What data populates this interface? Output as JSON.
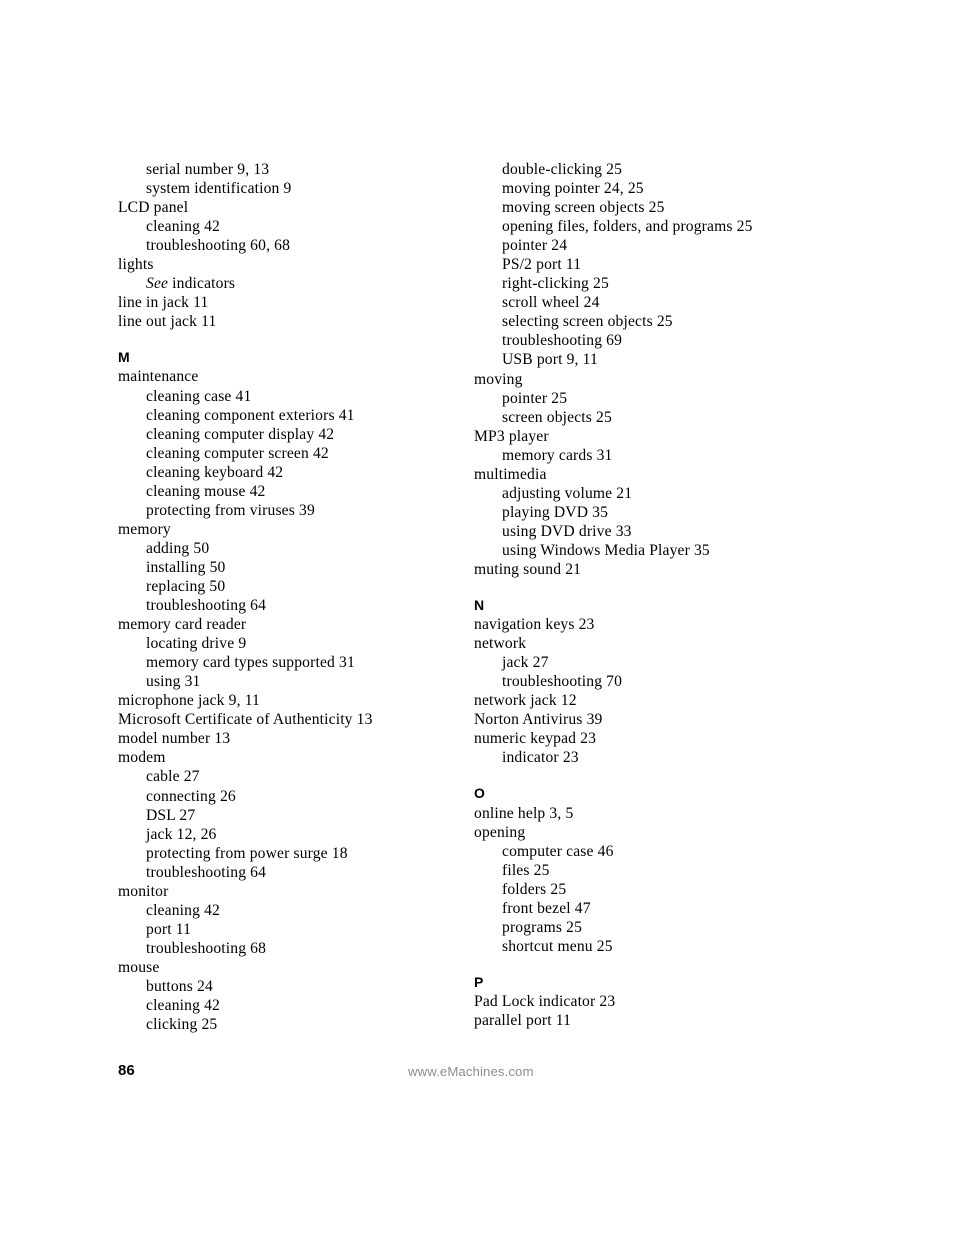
{
  "document": {
    "type": "index",
    "page_number": "86",
    "footer_url": "www.eMachines.com"
  },
  "columns": [
    {
      "name": "left-column",
      "blocks": [
        {
          "type": "entries",
          "entries": [
            {
              "level": 1,
              "text": "serial number 9, 13"
            },
            {
              "level": 1,
              "text": "system identification 9"
            },
            {
              "level": 0,
              "text": "LCD panel"
            },
            {
              "level": 1,
              "text": "cleaning 42"
            },
            {
              "level": 1,
              "text": "troubleshooting 60, 68"
            },
            {
              "level": 0,
              "text": "lights"
            },
            {
              "level": 1,
              "text": "See indicators",
              "italic_prefix": "See",
              "rest": " indicators"
            },
            {
              "level": 0,
              "text": "line in jack 11"
            },
            {
              "level": 0,
              "text": "line out jack 11"
            }
          ]
        },
        {
          "type": "section",
          "letter": "M",
          "entries": [
            {
              "level": 0,
              "text": "maintenance"
            },
            {
              "level": 1,
              "text": "cleaning case 41"
            },
            {
              "level": 1,
              "text": "cleaning component exteriors 41"
            },
            {
              "level": 1,
              "text": "cleaning computer display 42"
            },
            {
              "level": 1,
              "text": "cleaning computer screen 42"
            },
            {
              "level": 1,
              "text": "cleaning keyboard 42"
            },
            {
              "level": 1,
              "text": "cleaning mouse 42"
            },
            {
              "level": 1,
              "text": "protecting from viruses 39"
            },
            {
              "level": 0,
              "text": "memory"
            },
            {
              "level": 1,
              "text": "adding 50"
            },
            {
              "level": 1,
              "text": "installing 50"
            },
            {
              "level": 1,
              "text": "replacing 50"
            },
            {
              "level": 1,
              "text": "troubleshooting 64"
            },
            {
              "level": 0,
              "text": "memory card reader"
            },
            {
              "level": 1,
              "text": "locating drive 9"
            },
            {
              "level": 1,
              "text": "memory card types supported 31"
            },
            {
              "level": 1,
              "text": "using 31"
            },
            {
              "level": 0,
              "text": "microphone jack 9, 11"
            },
            {
              "level": 0,
              "text": "Microsoft Certificate of Authenticity 13"
            },
            {
              "level": 0,
              "text": "model number 13"
            },
            {
              "level": 0,
              "text": "modem"
            },
            {
              "level": 1,
              "text": "cable 27"
            },
            {
              "level": 1,
              "text": "connecting 26"
            },
            {
              "level": 1,
              "text": "DSL 27"
            },
            {
              "level": 1,
              "text": "jack 12, 26"
            },
            {
              "level": 1,
              "text": "protecting from power surge 18"
            },
            {
              "level": 1,
              "text": "troubleshooting 64"
            },
            {
              "level": 0,
              "text": "monitor"
            },
            {
              "level": 1,
              "text": "cleaning 42"
            },
            {
              "level": 1,
              "text": "port 11"
            },
            {
              "level": 1,
              "text": "troubleshooting 68"
            },
            {
              "level": 0,
              "text": "mouse"
            },
            {
              "level": 1,
              "text": "buttons 24"
            },
            {
              "level": 1,
              "text": "cleaning 42"
            },
            {
              "level": 1,
              "text": "clicking 25"
            }
          ]
        }
      ]
    },
    {
      "name": "right-column",
      "blocks": [
        {
          "type": "entries",
          "entries": [
            {
              "level": 1,
              "text": "double-clicking 25"
            },
            {
              "level": 1,
              "text": "moving pointer 24, 25"
            },
            {
              "level": 1,
              "text": "moving screen objects 25"
            },
            {
              "level": 1,
              "text": "opening files, folders, and programs 25"
            },
            {
              "level": 1,
              "text": "pointer 24"
            },
            {
              "level": 1,
              "text": "PS/2 port 11"
            },
            {
              "level": 1,
              "text": "right-clicking 25"
            },
            {
              "level": 1,
              "text": "scroll wheel 24"
            },
            {
              "level": 1,
              "text": "selecting screen objects 25"
            },
            {
              "level": 1,
              "text": "troubleshooting 69"
            },
            {
              "level": 1,
              "text": "USB port 9, 11"
            },
            {
              "level": 0,
              "text": "moving"
            },
            {
              "level": 1,
              "text": "pointer 25"
            },
            {
              "level": 1,
              "text": "screen objects 25"
            },
            {
              "level": 0,
              "text": "MP3 player"
            },
            {
              "level": 1,
              "text": "memory cards 31"
            },
            {
              "level": 0,
              "text": "multimedia"
            },
            {
              "level": 1,
              "text": "adjusting volume 21"
            },
            {
              "level": 1,
              "text": "playing DVD 35"
            },
            {
              "level": 1,
              "text": "using DVD drive 33"
            },
            {
              "level": 1,
              "text": "using Windows Media Player 35"
            },
            {
              "level": 0,
              "text": "muting sound 21"
            }
          ]
        },
        {
          "type": "section",
          "letter": "N",
          "entries": [
            {
              "level": 0,
              "text": "navigation keys 23"
            },
            {
              "level": 0,
              "text": "network"
            },
            {
              "level": 1,
              "text": "jack 27"
            },
            {
              "level": 1,
              "text": "troubleshooting 70"
            },
            {
              "level": 0,
              "text": "network jack 12"
            },
            {
              "level": 0,
              "text": "Norton Antivirus 39"
            },
            {
              "level": 0,
              "text": "numeric keypad 23"
            },
            {
              "level": 1,
              "text": "indicator 23"
            }
          ]
        },
        {
          "type": "section",
          "letter": "O",
          "entries": [
            {
              "level": 0,
              "text": "online help 3, 5"
            },
            {
              "level": 0,
              "text": "opening"
            },
            {
              "level": 1,
              "text": "computer case 46"
            },
            {
              "level": 1,
              "text": "files 25"
            },
            {
              "level": 1,
              "text": "folders 25"
            },
            {
              "level": 1,
              "text": "front bezel 47"
            },
            {
              "level": 1,
              "text": "programs 25"
            },
            {
              "level": 1,
              "text": "shortcut menu 25"
            }
          ]
        },
        {
          "type": "section",
          "letter": "P",
          "entries": [
            {
              "level": 0,
              "text": "Pad Lock indicator 23"
            },
            {
              "level": 0,
              "text": "parallel port 11"
            }
          ]
        }
      ]
    }
  ]
}
